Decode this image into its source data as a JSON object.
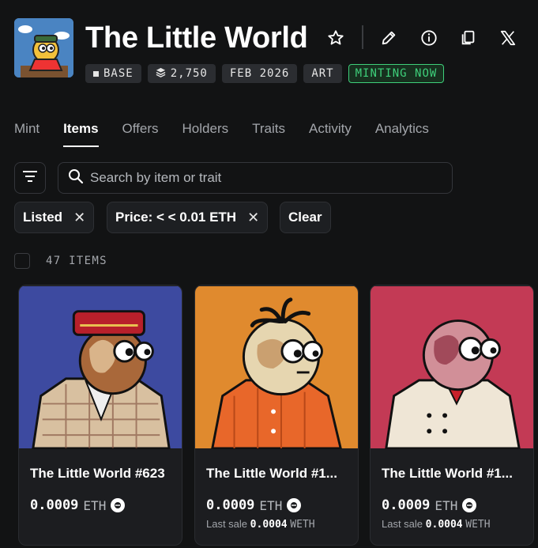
{
  "collection": {
    "title": "The Little World",
    "badges": {
      "chain": "BASE",
      "supply": "2,750",
      "date": "FEB 2026",
      "category": "ART",
      "status": "MINTING NOW"
    }
  },
  "header_icons": [
    "star-icon",
    "pencil-icon",
    "info-icon",
    "copy-icon",
    "x-logo-icon"
  ],
  "tabs": [
    "Mint",
    "Items",
    "Offers",
    "Holders",
    "Traits",
    "Activity",
    "Analytics"
  ],
  "active_tab": "Items",
  "search": {
    "placeholder": "Search by item or trait"
  },
  "filters": {
    "chips": [
      "Listed",
      "Price: < < 0.01 ETH"
    ],
    "clear_label": "Clear"
  },
  "results": {
    "count_label": "47 ITEMS"
  },
  "cards": [
    {
      "name": "The Little World #623",
      "price": "0.0009",
      "unit": "ETH",
      "last_sale_label": "",
      "last_sale_value": "",
      "last_sale_unit": "",
      "bg": "#3d4aa0"
    },
    {
      "name": "The Little World #1...",
      "price": "0.0009",
      "unit": "ETH",
      "last_sale_label": "Last sale",
      "last_sale_value": "0.0004",
      "last_sale_unit": "WETH",
      "bg": "#e08a2e"
    },
    {
      "name": "The Little World #1...",
      "price": "0.0009",
      "unit": "ETH",
      "last_sale_label": "Last sale",
      "last_sale_value": "0.0004",
      "last_sale_unit": "WETH",
      "bg": "#c33a55"
    }
  ],
  "colors": {
    "background": "#121314",
    "accent_green": "#3ecf7a",
    "badge_bg": "#2b2d31"
  }
}
